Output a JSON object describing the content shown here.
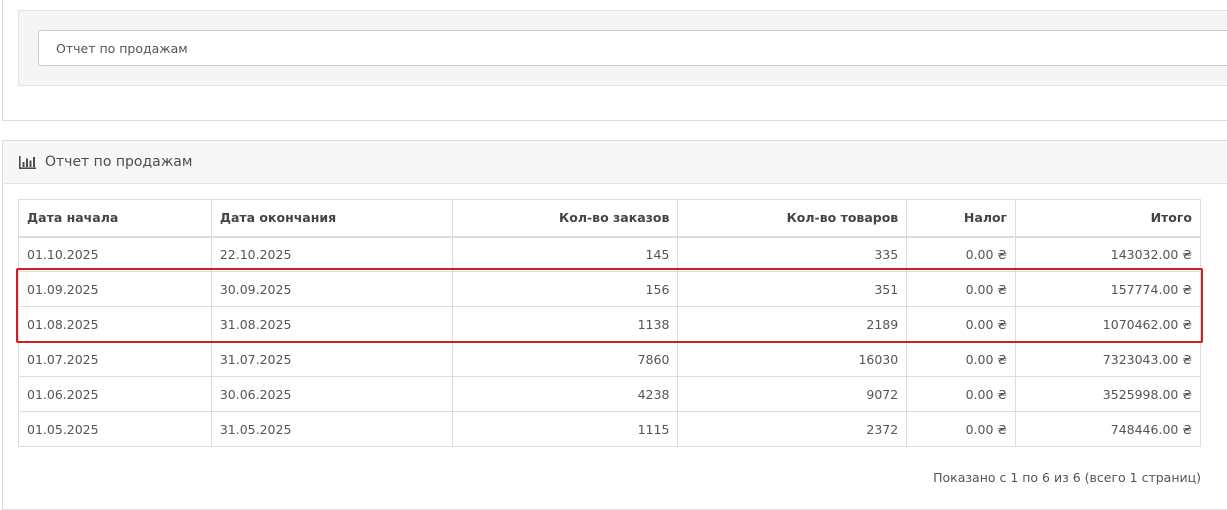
{
  "filter": {
    "report_select_value": "Отчет по продажам"
  },
  "report": {
    "title": "Отчет по продажам",
    "title_icon": "bar-chart-icon",
    "columns": {
      "start": "Дата начала",
      "end": "Дата окончания",
      "orders": "Кол-во заказов",
      "products": "Кол-во товаров",
      "tax": "Налог",
      "total": "Итого"
    },
    "rows": [
      {
        "start": "01.10.2025",
        "end": "22.10.2025",
        "orders": "145",
        "products": "335",
        "tax": "0.00 ₴",
        "total": "143032.00 ₴"
      },
      {
        "start": "01.09.2025",
        "end": "30.09.2025",
        "orders": "156",
        "products": "351",
        "tax": "0.00 ₴",
        "total": "157774.00 ₴"
      },
      {
        "start": "01.08.2025",
        "end": "31.08.2025",
        "orders": "1138",
        "products": "2189",
        "tax": "0.00 ₴",
        "total": "1070462.00 ₴"
      },
      {
        "start": "01.07.2025",
        "end": "31.07.2025",
        "orders": "7860",
        "products": "16030",
        "tax": "0.00 ₴",
        "total": "7323043.00 ₴"
      },
      {
        "start": "01.06.2025",
        "end": "30.06.2025",
        "orders": "4238",
        "products": "9072",
        "tax": "0.00 ₴",
        "total": "3525998.00 ₴"
      },
      {
        "start": "01.05.2025",
        "end": "31.05.2025",
        "orders": "1115",
        "products": "2372",
        "tax": "0.00 ₴",
        "total": "748446.00 ₴"
      }
    ],
    "pagination_text": "Показано с 1 по 6 из 6 (всего 1 страниц)"
  },
  "colors": {
    "highlight": "#cc1f26"
  }
}
